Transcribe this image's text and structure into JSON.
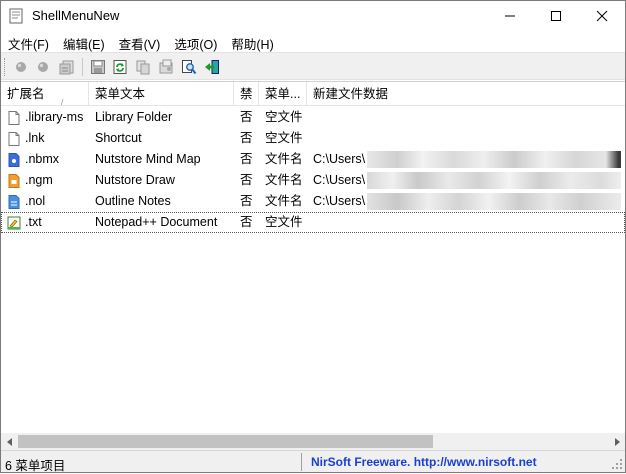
{
  "window": {
    "title": "ShellMenuNew"
  },
  "menu": [
    "文件(F)",
    "编辑(E)",
    "查看(V)",
    "选项(O)",
    "帮助(H)"
  ],
  "toolbar": {
    "buttons": [
      "disable-icon",
      "enable-icon",
      "properties-icon",
      "save-icon",
      "refresh-icon",
      "copy-icon",
      "html-report-icon",
      "find-icon",
      "exit-icon"
    ]
  },
  "columns": [
    "扩展名",
    "菜单文本",
    "禁",
    "菜单...",
    "新建文件数据"
  ],
  "rows": [
    {
      "ext": ".library-ms",
      "text": "Library Folder",
      "disabled": "否",
      "type": "空文件",
      "data": "",
      "icon": "file-icon"
    },
    {
      "ext": ".lnk",
      "text": "Shortcut",
      "disabled": "否",
      "type": "空文件",
      "data": "",
      "icon": "file-icon"
    },
    {
      "ext": ".nbmx",
      "text": "Nutstore Mind Map",
      "disabled": "否",
      "type": "文件名",
      "data": "C:\\Users\\",
      "icon": "mindmap-file-icon"
    },
    {
      "ext": ".ngm",
      "text": "Nutstore Draw",
      "disabled": "否",
      "type": "文件名",
      "data": "C:\\Users\\",
      "icon": "draw-file-icon"
    },
    {
      "ext": ".nol",
      "text": "Outline Notes",
      "disabled": "否",
      "type": "文件名",
      "data": "C:\\Users\\",
      "icon": "outline-file-icon"
    },
    {
      "ext": ".txt",
      "text": "Notepad++ Document",
      "disabled": "否",
      "type": "空文件",
      "data": "",
      "icon": "notepad-file-icon"
    }
  ],
  "status": {
    "count": "6 菜单项目",
    "link": "NirSoft Freeware.  http://www.nirsoft.net"
  },
  "colors": {
    "link": "#1a3fd1",
    "toolbar_bg": "#f0f0f0"
  }
}
